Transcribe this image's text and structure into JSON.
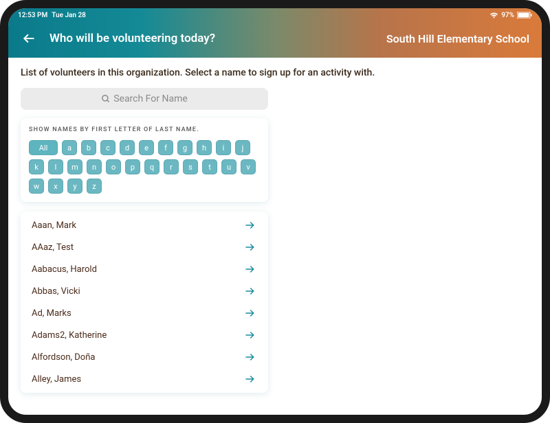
{
  "status": {
    "time": "12:53 PM",
    "date": "Tue Jan 28",
    "battery": "97%"
  },
  "header": {
    "title": "Who will be volunteering today?",
    "school": "South Hill Elementary School"
  },
  "instruction": "List of volunteers in this organization. Select a name to sign up for an activity with.",
  "search": {
    "placeholder": "Search For Name"
  },
  "filter": {
    "label": "SHOW NAMES BY FIRST LETTER OF LAST NAME.",
    "all": "All",
    "letters": [
      "a",
      "b",
      "c",
      "d",
      "e",
      "f",
      "g",
      "h",
      "i",
      "j",
      "k",
      "l",
      "m",
      "n",
      "o",
      "p",
      "q",
      "r",
      "s",
      "t",
      "u",
      "v",
      "w",
      "x",
      "y",
      "z"
    ]
  },
  "volunteers": [
    {
      "name": "Aaan, Mark"
    },
    {
      "name": "AAaz, Test"
    },
    {
      "name": "Aabacus, Harold"
    },
    {
      "name": "Abbas, Vicki"
    },
    {
      "name": "Ad, Marks"
    },
    {
      "name": "Adams2, Katherine"
    },
    {
      "name": "Alfordson, Doña"
    },
    {
      "name": "Alley, James"
    }
  ],
  "colors": {
    "accent": "#1a8aa0",
    "letter_btn": "#6bb8c2"
  }
}
